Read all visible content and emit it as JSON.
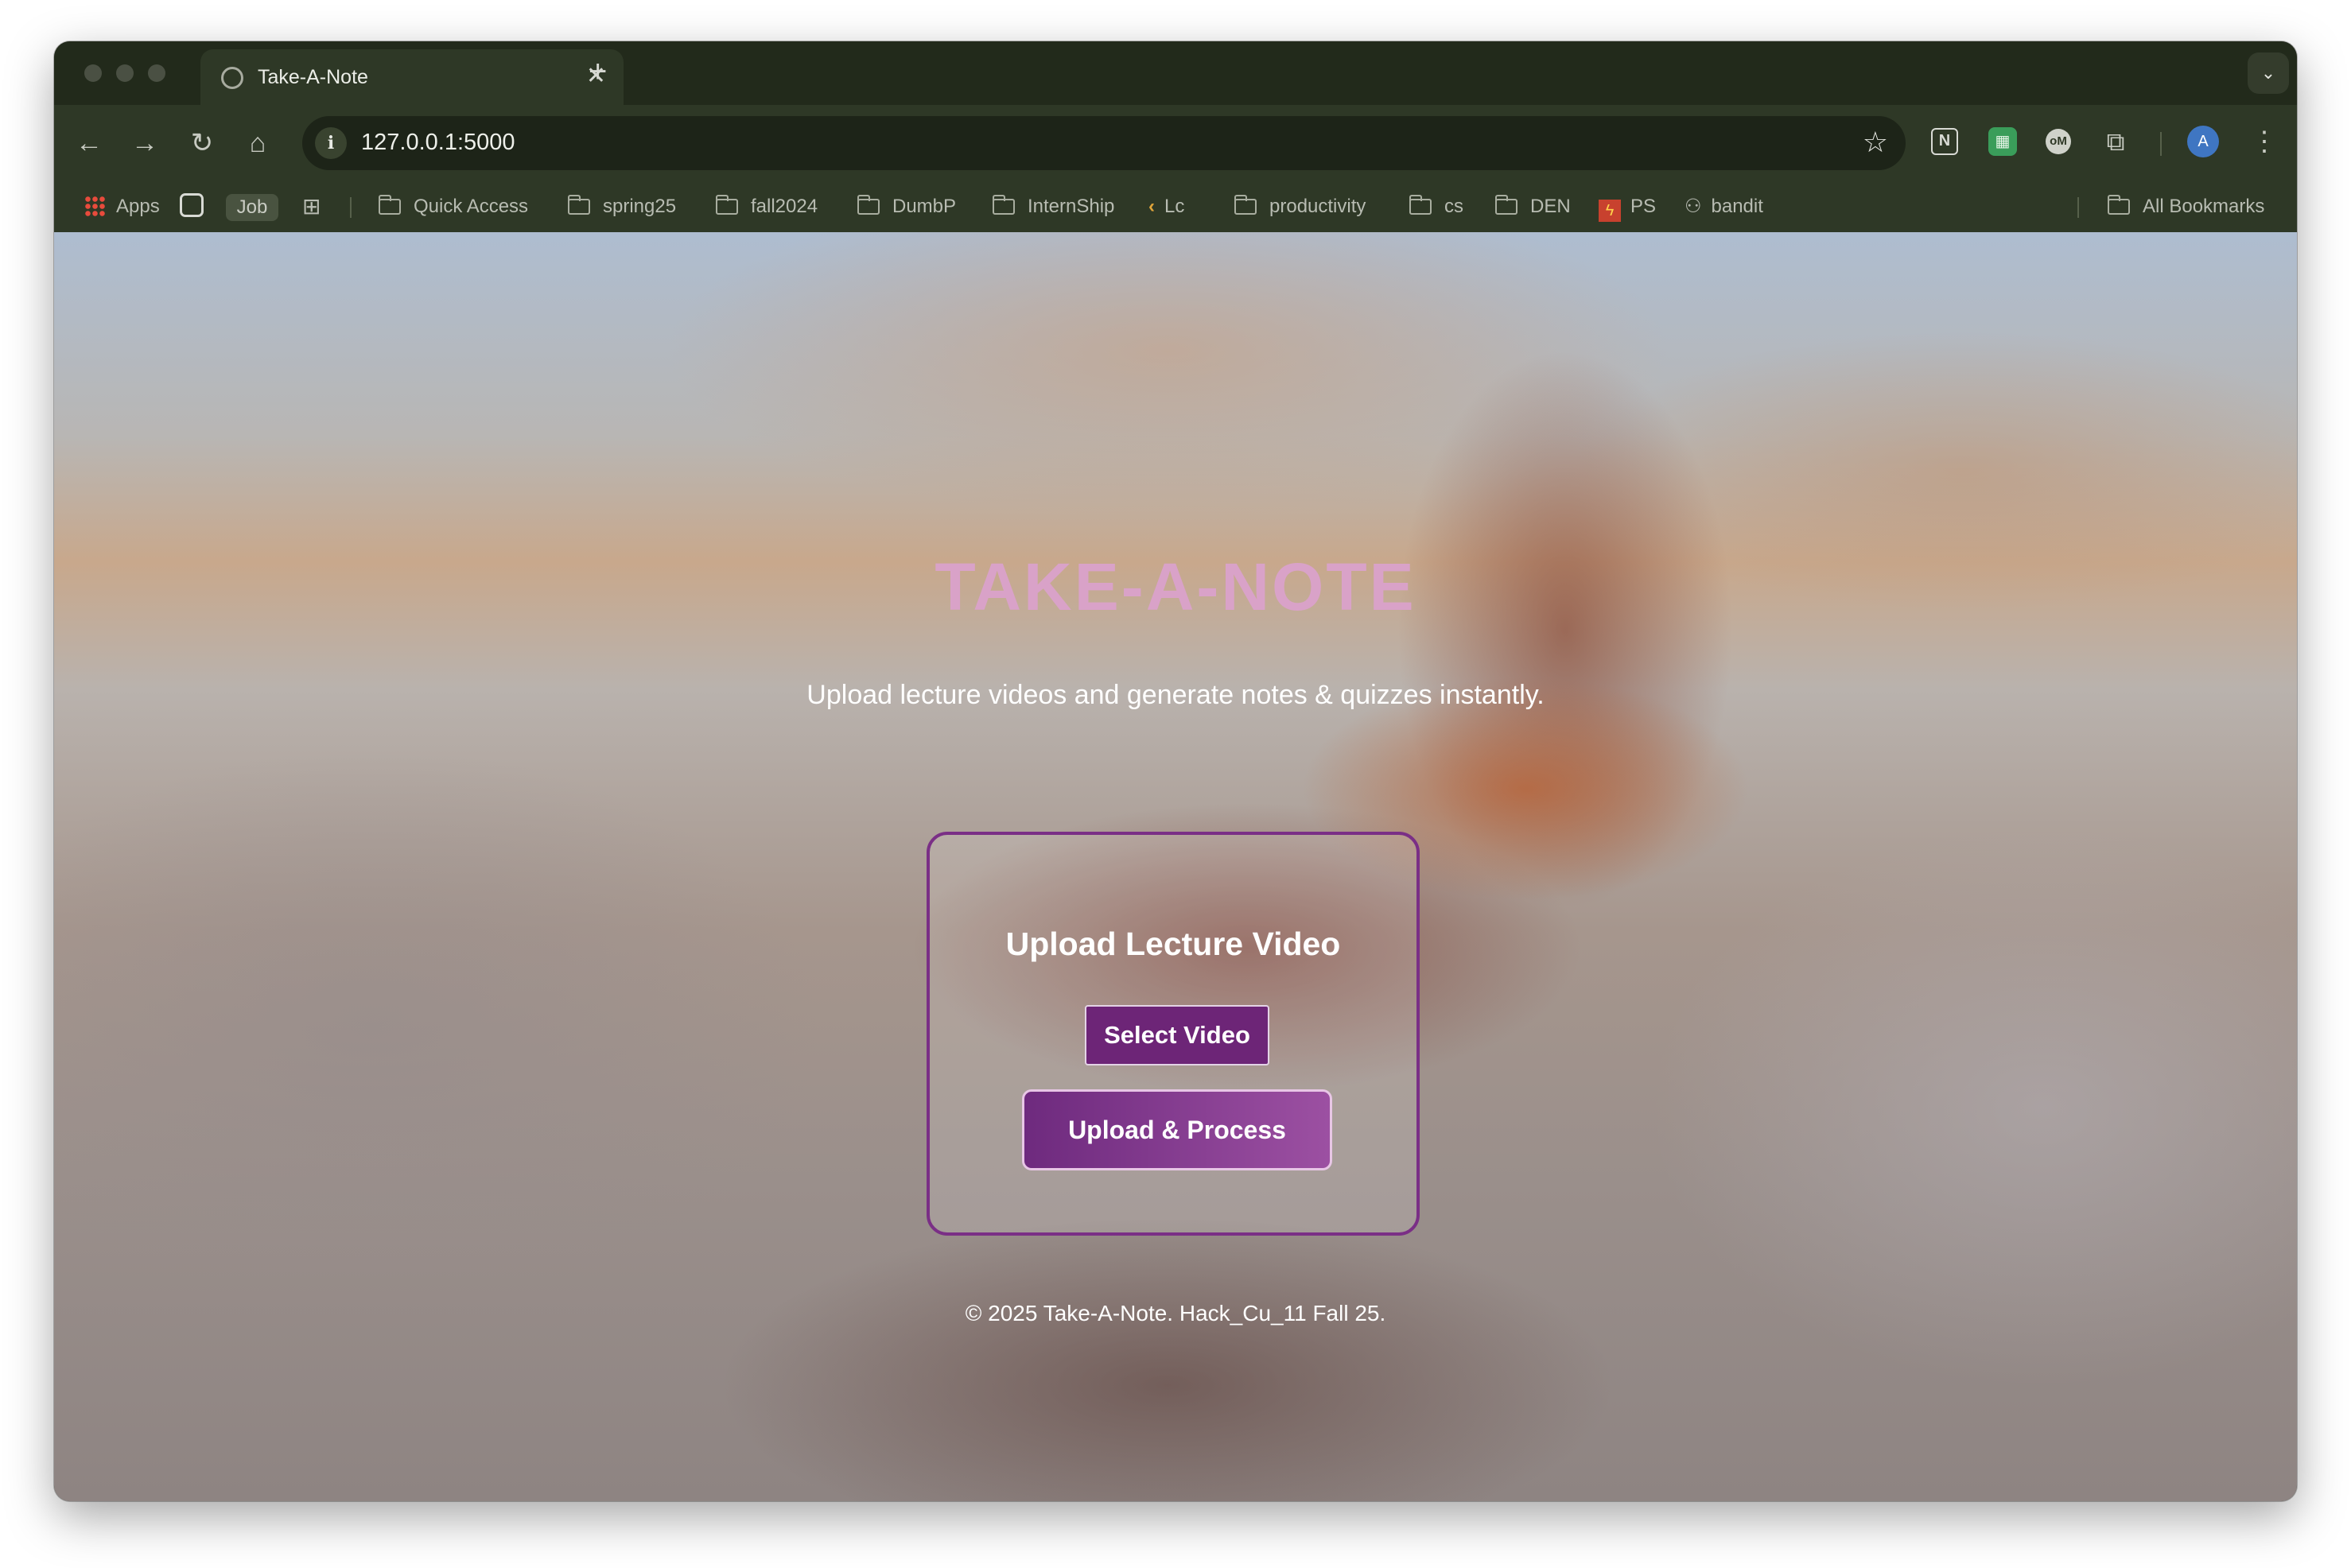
{
  "browser": {
    "tab": {
      "title": "Take-A-Note"
    },
    "new_tab_symbol": "+",
    "tab_close_symbol": "✕",
    "address_bar": {
      "url": "127.0.0.1:5000"
    },
    "bookmarks": {
      "apps_label": "Apps",
      "job_label": "Job",
      "folders": [
        "Quick Access",
        "spring25",
        "fall2024",
        "DumbP",
        "InternShip"
      ],
      "lc_label": "Lc",
      "folders2": [
        "productivity",
        "cs",
        "DEN"
      ],
      "ps_label": "PS",
      "bandit_label": "bandit",
      "all_bookmarks_label": "All Bookmarks"
    },
    "avatar_initial": "A",
    "extensions": [
      "notion-icon",
      "sheets-icon",
      "monitor-icon",
      "puzzle-icon"
    ]
  },
  "page": {
    "title": "TAKE-A-NOTE",
    "subtitle": "Upload lecture videos and generate notes & quizzes instantly.",
    "upload_card": {
      "title": "Upload Lecture Video",
      "select_button": "Select Video",
      "upload_button": "Upload & Process"
    },
    "footer": "© 2025 Take-A-Note. Hack_Cu_11 Fall 25."
  },
  "colors": {
    "title_pink": "#d9a2c8",
    "button_purple": "#6d2577",
    "card_border": "#7a2f86",
    "chrome_dark": "#222a1b",
    "toolbar": "#2e3826"
  }
}
